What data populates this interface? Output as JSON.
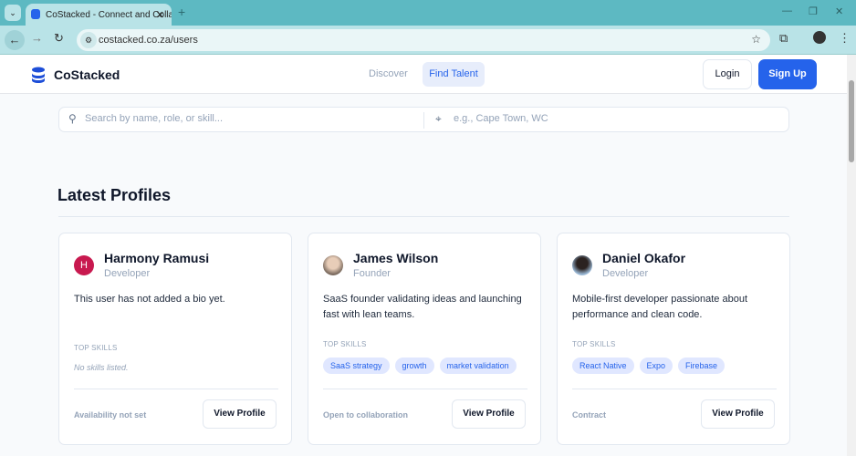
{
  "browser": {
    "tab_title": "CoStacked - Connect and Collab",
    "url": "costacked.co.za/users"
  },
  "nav": {
    "brand": "CoStacked",
    "discover": "Discover",
    "find_talent": "Find Talent",
    "login": "Login",
    "signup": "Sign Up"
  },
  "search": {
    "query_placeholder": "Search by name, role, or skill...",
    "location_placeholder": "e.g., Cape Town, WC"
  },
  "section_title": "Latest Profiles",
  "top_skills_label": "TOP SKILLS",
  "view_profile": "View Profile",
  "profiles": [
    {
      "name": "Harmony Ramusi",
      "role": "Developer",
      "initial": "H",
      "avatar_color": "#c8194f",
      "bio": "This user has not added a bio yet.",
      "skills": [],
      "no_skills": "No skills listed.",
      "availability": "Availability not set"
    },
    {
      "name": "James Wilson",
      "role": "Founder",
      "bio": "SaaS founder validating ideas and launching fast with lean teams.",
      "skills": [
        "SaaS strategy",
        "growth",
        "market validation"
      ],
      "availability": "Open to collaboration"
    },
    {
      "name": "Daniel Okafor",
      "role": "Developer",
      "bio": "Mobile-first developer passionate about performance and clean code.",
      "skills": [
        "React Native",
        "Expo",
        "Firebase"
      ],
      "availability": "Contract"
    }
  ]
}
